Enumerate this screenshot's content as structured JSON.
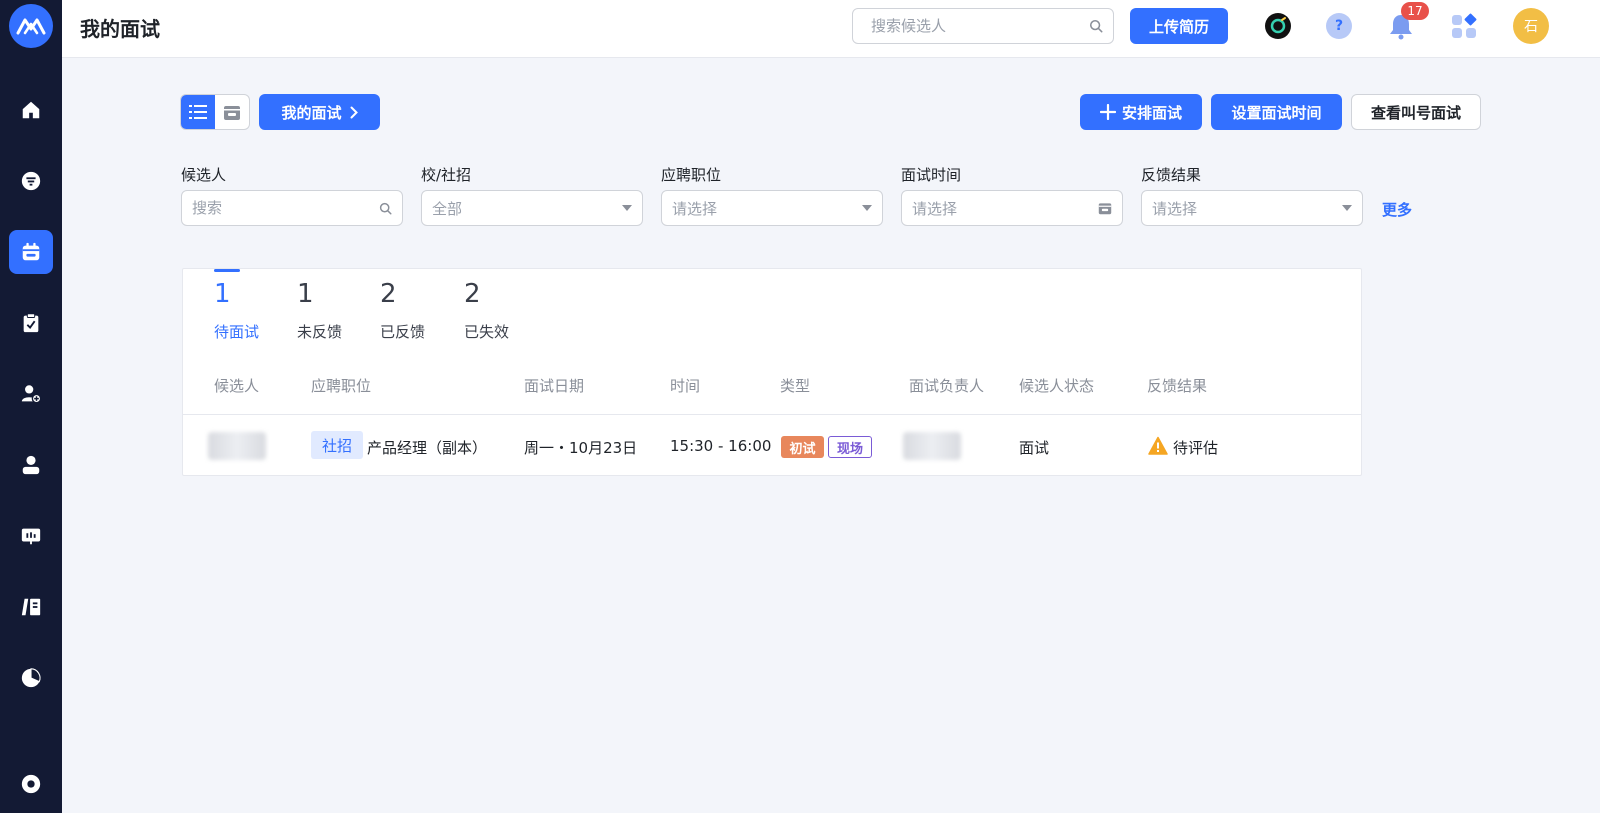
{
  "header": {
    "title": "我的面试",
    "search_placeholder": "搜索候选人",
    "upload_label": "上传简历",
    "notification_count": "17",
    "avatar_text": "石",
    "help_glyph": "?"
  },
  "sidebar": {
    "items": [
      {
        "icon": "home-icon"
      },
      {
        "icon": "filter-icon"
      },
      {
        "icon": "calendar-icon",
        "active": true
      },
      {
        "icon": "clipboard-icon"
      },
      {
        "icon": "add-user-icon"
      },
      {
        "icon": "user-icon"
      },
      {
        "icon": "presentation-icon"
      },
      {
        "icon": "book-icon"
      },
      {
        "icon": "pie-chart-icon"
      },
      {
        "icon": "settings-icon"
      }
    ]
  },
  "toolbar": {
    "my_interview_label": "我的面试",
    "schedule_label": "安排面试",
    "set_time_label": "设置面试时间",
    "view_call_label": "查看叫号面试"
  },
  "filters": {
    "candidate": {
      "label": "候选人",
      "placeholder": "搜索"
    },
    "recruit_type": {
      "label": "校/社招",
      "value": "全部"
    },
    "position": {
      "label": "应聘职位",
      "placeholder": "请选择"
    },
    "interview_time": {
      "label": "面试时间",
      "placeholder": "请选择"
    },
    "feedback": {
      "label": "反馈结果",
      "placeholder": "请选择"
    },
    "more_label": "更多"
  },
  "stats": [
    {
      "count": "1",
      "label": "待面试",
      "active": true
    },
    {
      "count": "1",
      "label": "未反馈"
    },
    {
      "count": "2",
      "label": "已反馈"
    },
    {
      "count": "2",
      "label": "已失效"
    }
  ],
  "table": {
    "columns": [
      "候选人",
      "应聘职位",
      "面试日期",
      "时间",
      "类型",
      "面试负责人",
      "候选人状态",
      "反馈结果"
    ],
    "rows": [
      {
        "recruit_tag": "社招",
        "position": "产品经理（副本）",
        "date": "周一・10月23日",
        "time": "15:30 - 16:00",
        "type_tags": [
          "初试",
          "现场"
        ],
        "status": "面试",
        "feedback": "待评估"
      }
    ]
  },
  "colors": {
    "primary": "#3370ff",
    "sidebar": "#131a34",
    "tag_first": "#e8875c",
    "tag_onsite": "#7a5bd6",
    "warning": "#f5a623"
  }
}
